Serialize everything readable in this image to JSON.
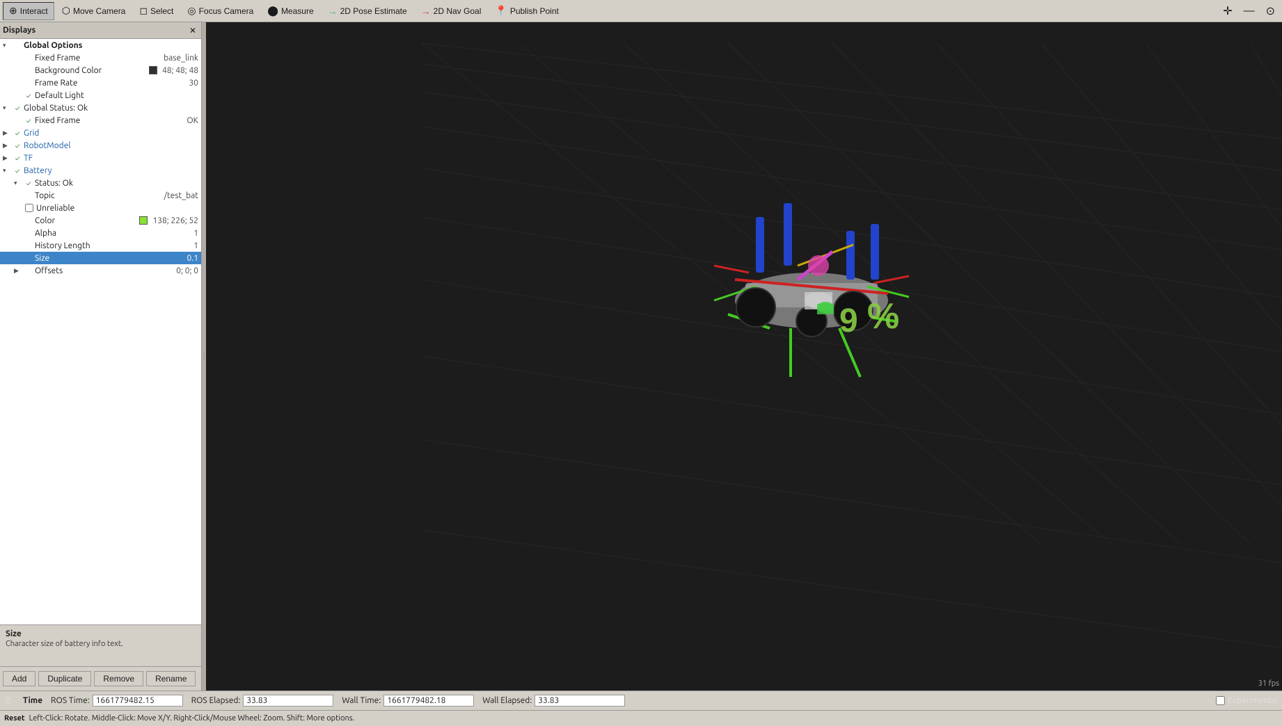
{
  "toolbar": {
    "items": [
      {
        "label": "Interact",
        "icon": "⊕",
        "active": true
      },
      {
        "label": "Move Camera",
        "icon": "⬡"
      },
      {
        "label": "Select",
        "icon": "◻"
      },
      {
        "label": "Focus Camera",
        "icon": "◎"
      },
      {
        "label": "Measure",
        "icon": "⬤"
      },
      {
        "label": "2D Pose Estimate",
        "icon": "→"
      },
      {
        "label": "2D Nav Goal",
        "icon": "→"
      },
      {
        "label": "Publish Point",
        "icon": "📍"
      }
    ],
    "end_icons": [
      "+",
      "—",
      "⊙"
    ]
  },
  "panel": {
    "title": "Displays",
    "tree": [
      {
        "id": "global-options",
        "indent": 0,
        "arrow": "▾",
        "check": "",
        "label": "Global Options",
        "value": "",
        "bold": true,
        "color": null,
        "expanded": true
      },
      {
        "id": "fixed-frame",
        "indent": 1,
        "arrow": "",
        "check": "",
        "label": "Fixed Frame",
        "value": "base_link",
        "bold": false,
        "color": null
      },
      {
        "id": "background-color",
        "indent": 1,
        "arrow": "",
        "check": "",
        "label": "Background Color",
        "value": "48; 48; 48",
        "bold": false,
        "colorSwatch": "#303030"
      },
      {
        "id": "frame-rate",
        "indent": 1,
        "arrow": "",
        "check": "",
        "label": "Frame Rate",
        "value": "30",
        "bold": false,
        "color": null
      },
      {
        "id": "default-light",
        "indent": 1,
        "arrow": "",
        "check": "checked",
        "label": "Default Light",
        "value": "",
        "bold": false,
        "color": null
      },
      {
        "id": "global-status",
        "indent": 0,
        "arrow": "▾",
        "check": "checked",
        "label": "Global Status: Ok",
        "value": "",
        "bold": false,
        "color": null,
        "expanded": true
      },
      {
        "id": "fixed-frame-status",
        "indent": 1,
        "arrow": "",
        "check": "checked",
        "label": "Fixed Frame",
        "value": "OK",
        "bold": false,
        "color": null
      },
      {
        "id": "grid",
        "indent": 0,
        "arrow": "▶",
        "check": "checked",
        "label": "Grid",
        "value": "",
        "bold": false,
        "isBlue": true
      },
      {
        "id": "robot-model",
        "indent": 0,
        "arrow": "▶",
        "check": "checked",
        "label": "RobotModel",
        "value": "",
        "bold": false,
        "isBlue": true
      },
      {
        "id": "tf",
        "indent": 0,
        "arrow": "▶",
        "check": "checked",
        "label": "TF",
        "value": "",
        "bold": false,
        "isBlue": true
      },
      {
        "id": "battery",
        "indent": 0,
        "arrow": "▾",
        "check": "checked",
        "label": "Battery",
        "value": "",
        "bold": false,
        "isBlue": true,
        "expanded": true
      },
      {
        "id": "battery-status",
        "indent": 1,
        "arrow": "▾",
        "check": "checked",
        "label": "Status: Ok",
        "value": "",
        "bold": false
      },
      {
        "id": "battery-topic",
        "indent": 1,
        "arrow": "",
        "check": "",
        "label": "Topic",
        "value": "/test_bat",
        "bold": false
      },
      {
        "id": "battery-unreliable",
        "indent": 1,
        "arrow": "",
        "check": "",
        "label": "Unreliable",
        "value": "",
        "bold": false,
        "checkboxUnchecked": true
      },
      {
        "id": "battery-color",
        "indent": 1,
        "arrow": "",
        "check": "",
        "label": "Color",
        "value": "138; 226; 52",
        "bold": false,
        "colorSwatch": "#8ae234"
      },
      {
        "id": "battery-alpha",
        "indent": 1,
        "arrow": "",
        "check": "",
        "label": "Alpha",
        "value": "1",
        "bold": false
      },
      {
        "id": "battery-history",
        "indent": 1,
        "arrow": "",
        "check": "",
        "label": "History Length",
        "value": "1",
        "bold": false
      },
      {
        "id": "battery-size",
        "indent": 1,
        "arrow": "",
        "check": "",
        "label": "Size",
        "value": "0.1",
        "bold": false,
        "selected": true
      },
      {
        "id": "battery-offsets",
        "indent": 1,
        "arrow": "▶",
        "check": "",
        "label": "Offsets",
        "value": "0; 0; 0",
        "bold": false
      }
    ],
    "info_title": "Size",
    "info_desc": "Character size of battery info text.",
    "buttons": [
      "Add",
      "Duplicate",
      "Remove",
      "Rename"
    ]
  },
  "time": {
    "section_label": "Time",
    "ros_time_label": "ROS Time:",
    "ros_time_value": "1661779482.15",
    "ros_elapsed_label": "ROS Elapsed:",
    "ros_elapsed_value": "33.83",
    "wall_time_label": "Wall Time:",
    "wall_time_value": "1661779482.18",
    "wall_elapsed_label": "Wall Elapsed:",
    "wall_elapsed_value": "33.83",
    "experimental_label": "Experimental"
  },
  "hints": {
    "reset": "Reset",
    "hint_text": "Left-Click: Rotate.  Middle-Click: Move X/Y.  Right-Click/Mouse Wheel: Zoom.  Shift: More options."
  },
  "fps": "31 fps",
  "viewport": {
    "bg_color": "#1c1c1c"
  }
}
